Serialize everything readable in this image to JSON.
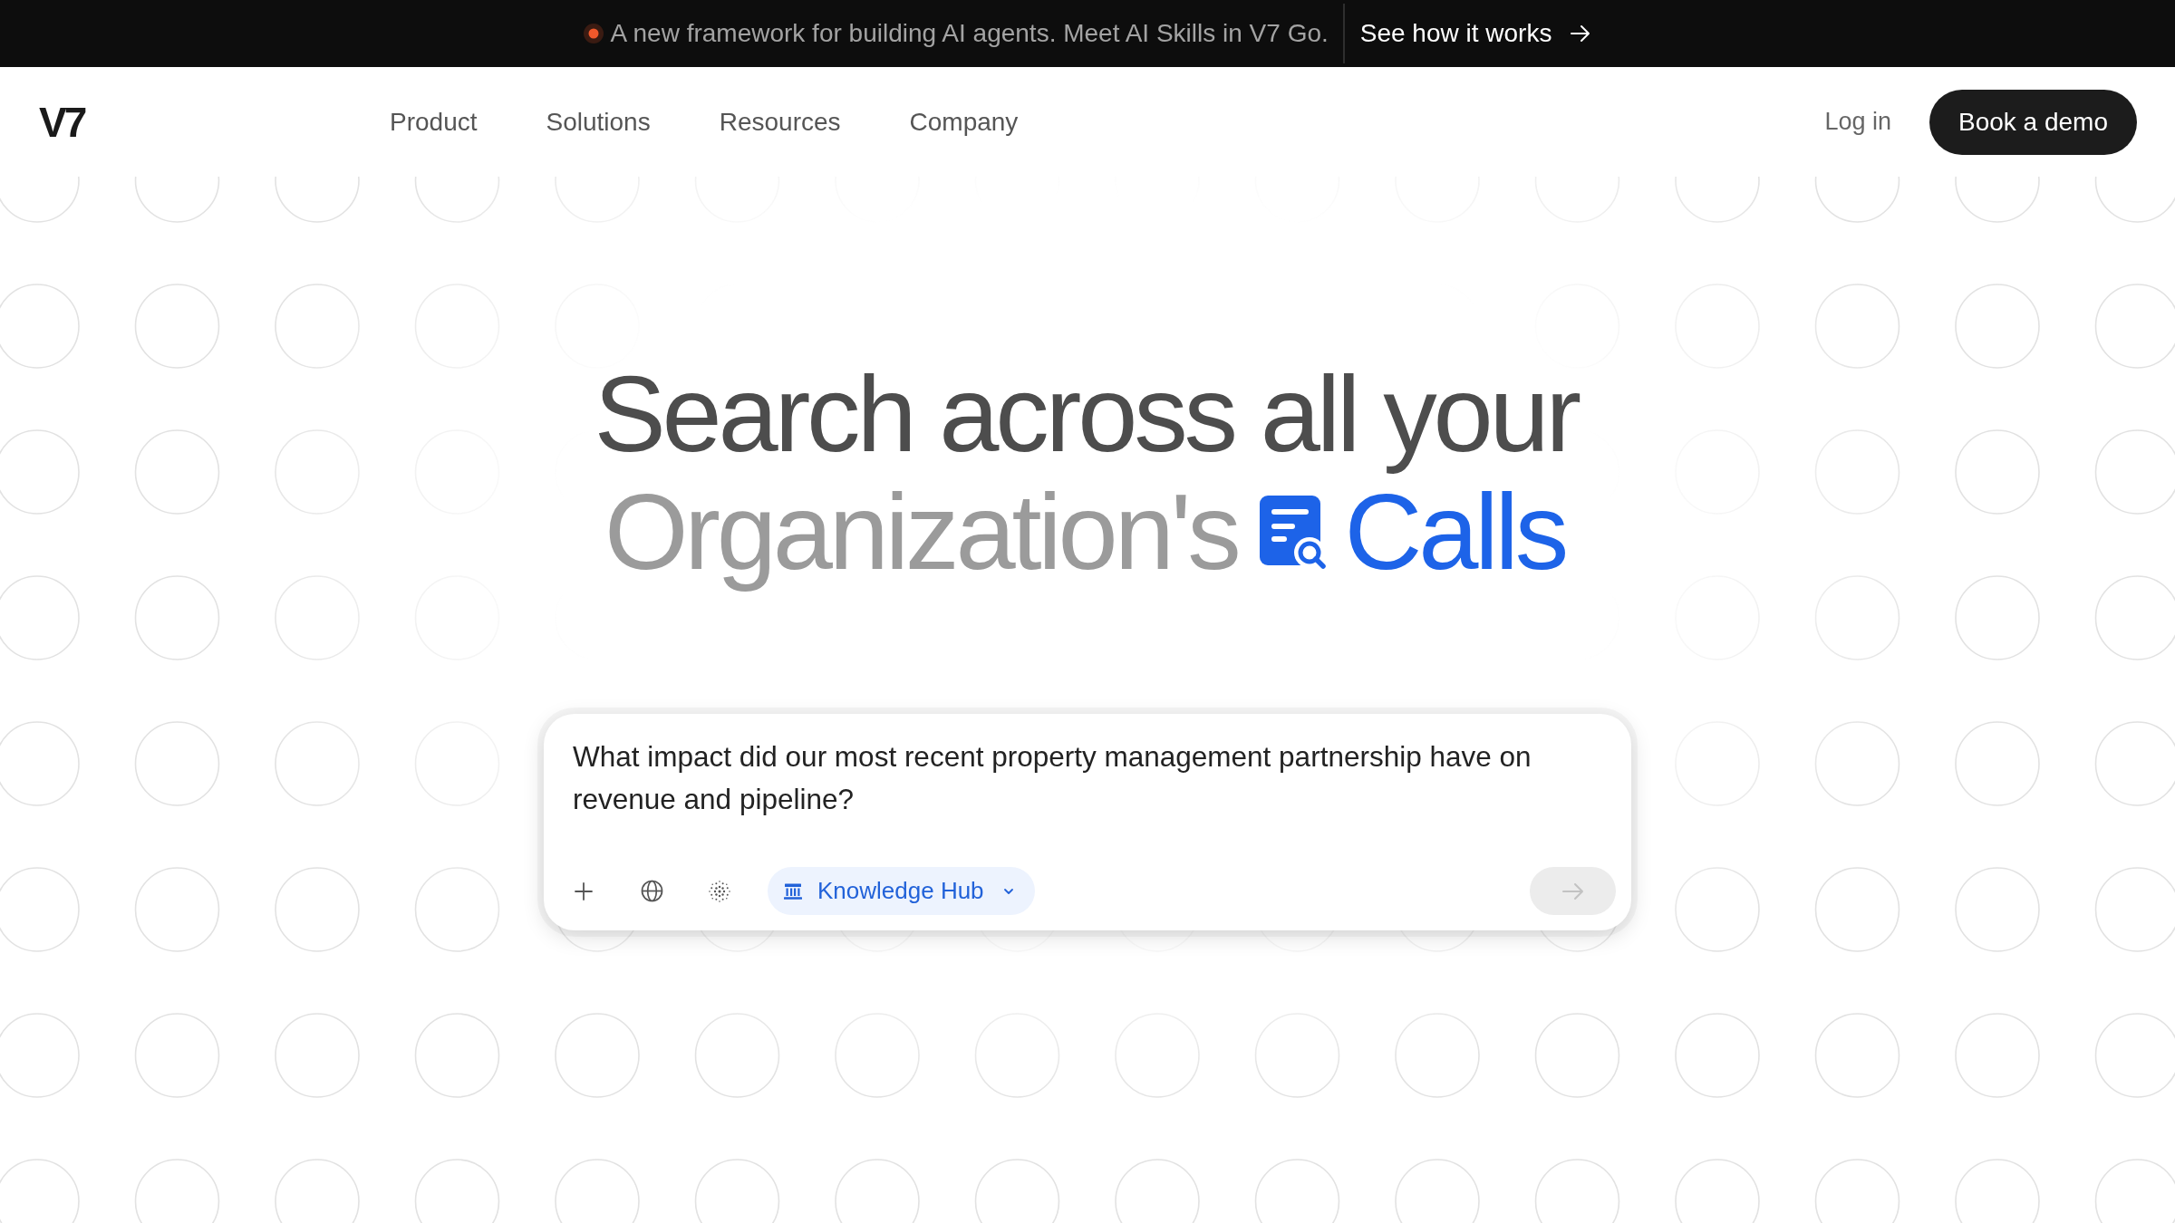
{
  "announcement": {
    "text": "A new framework for building AI agents. Meet AI Skills in V7 Go.",
    "link": "See how it works"
  },
  "nav": {
    "logo": "V7",
    "items": [
      {
        "label": "Product"
      },
      {
        "label": "Solutions"
      },
      {
        "label": "Resources"
      },
      {
        "label": "Company"
      }
    ],
    "login": "Log in",
    "cta": "Book a demo"
  },
  "hero": {
    "title": "Search across all your",
    "subject": "Organization's",
    "highlight": "Calls"
  },
  "prompt": {
    "value": "What impact did our most recent property management partnership have on revenue and pipeline?",
    "source": "Knowledge Hub",
    "send_button": {
      "disabled": true
    }
  }
}
